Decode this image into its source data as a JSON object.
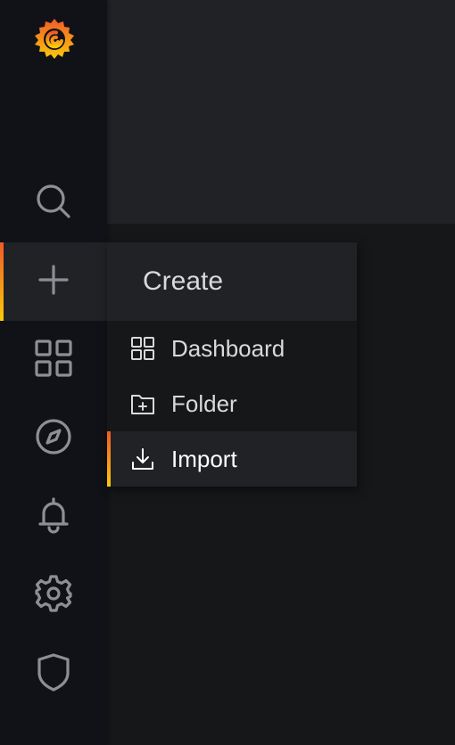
{
  "sidenav": {
    "logo_icon": "grafana-logo-icon",
    "items": [
      {
        "icon": "search-icon"
      },
      {
        "icon": "plus-icon",
        "active": true
      },
      {
        "icon": "apps-icon"
      },
      {
        "icon": "compass-icon"
      },
      {
        "icon": "bell-icon"
      },
      {
        "icon": "cog-icon"
      },
      {
        "icon": "shield-icon"
      }
    ]
  },
  "create_menu": {
    "title": "Create",
    "items": [
      {
        "label": "Dashboard",
        "icon": "apps-icon"
      },
      {
        "label": "Folder",
        "icon": "folder-plus-icon"
      },
      {
        "label": "Import",
        "icon": "import-icon",
        "active": true
      }
    ]
  },
  "colors": {
    "background": "#161719",
    "sidebar": "#111217",
    "panel": "#202226",
    "text": "#d8d9da",
    "icon": "#8e8e95",
    "accent_start": "#f05a28",
    "accent_end": "#fbca0a"
  }
}
